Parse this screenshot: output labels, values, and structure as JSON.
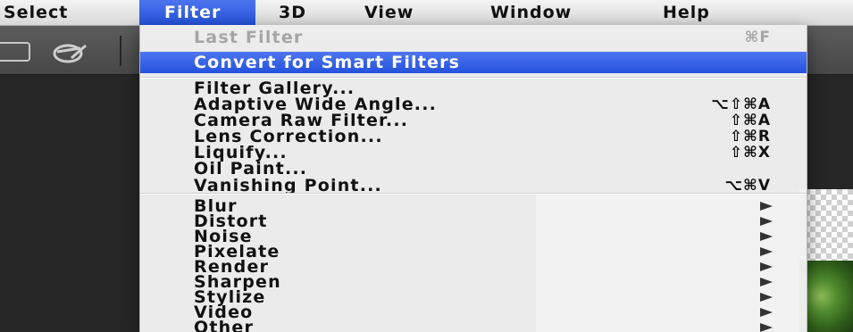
{
  "menubar": {
    "items": [
      {
        "label": "Select",
        "active": false
      },
      {
        "label": "Filter",
        "active": true
      },
      {
        "label": "3D",
        "active": false
      },
      {
        "label": "View",
        "active": false
      },
      {
        "label": "Window",
        "active": false
      },
      {
        "label": "Help",
        "active": false
      }
    ]
  },
  "filter_menu": {
    "last_filter": {
      "label": "Last Filter",
      "shortcut": "⌘F",
      "enabled": false
    },
    "convert_smart": {
      "label": "Convert for Smart Filters",
      "highlighted": true
    },
    "group1": [
      {
        "label": "Filter Gallery...",
        "shortcut": ""
      },
      {
        "label": "Adaptive Wide Angle...",
        "shortcut": "⌥⇧⌘A"
      },
      {
        "label": "Camera Raw Filter...",
        "shortcut": "⇧⌘A"
      },
      {
        "label": "Lens Correction...",
        "shortcut": "⇧⌘R"
      },
      {
        "label": "Liquify...",
        "shortcut": "⇧⌘X"
      },
      {
        "label": "Oil Paint...",
        "shortcut": ""
      },
      {
        "label": "Vanishing Point...",
        "shortcut": "⌥⌘V"
      }
    ],
    "submenus": [
      {
        "label": "Blur"
      },
      {
        "label": "Distort"
      },
      {
        "label": "Noise"
      },
      {
        "label": "Pixelate"
      },
      {
        "label": "Render"
      },
      {
        "label": "Sharpen"
      },
      {
        "label": "Stylize"
      },
      {
        "label": "Video"
      },
      {
        "label": "Other"
      }
    ]
  },
  "colors": {
    "highlight": "#2e5ce6",
    "menu_background": "#f2f2f2",
    "disabled_text": "#a5a5a5",
    "app_background": "#2b2b2b"
  },
  "icons": {
    "toolbar_left": "tool-preset-icon",
    "toolbar_brush": "brush-icon",
    "submenu_arrow": "submenu-arrow-icon"
  }
}
